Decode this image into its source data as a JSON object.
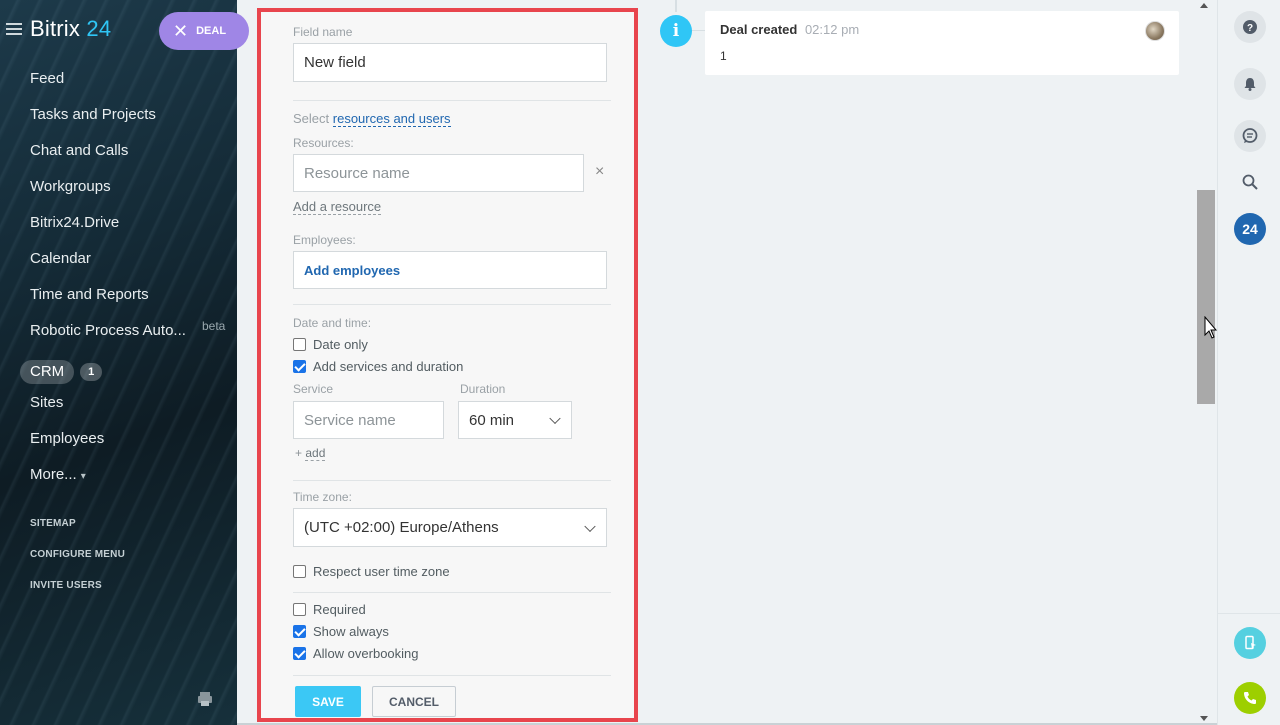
{
  "sidebar": {
    "logo_main": "Bitrix",
    "logo_num": "24",
    "deal_pill_label": "DEAL",
    "items": [
      {
        "label": "Feed"
      },
      {
        "label": "Tasks and Projects"
      },
      {
        "label": "Chat and Calls"
      },
      {
        "label": "Workgroups"
      },
      {
        "label": "Bitrix24.Drive"
      },
      {
        "label": "Calendar"
      },
      {
        "label": "Time and Reports"
      },
      {
        "label": "Robotic Process Auto...",
        "tag": "beta"
      }
    ],
    "crm": {
      "label": "CRM",
      "count": "1"
    },
    "items_after": [
      {
        "label": "Sites"
      },
      {
        "label": "Employees"
      },
      {
        "label": "More..."
      }
    ],
    "small_links": [
      "SITEMAP",
      "CONFIGURE MENU",
      "INVITE USERS"
    ]
  },
  "form": {
    "field_name_label": "Field name",
    "field_name_value": "New field",
    "select_prefix": "Select",
    "select_link": "resources and users",
    "resources_label": "Resources:",
    "resource_placeholder": "Resource name",
    "remove_symbol": "×",
    "add_resource": "Add a resource",
    "employees_label": "Employees:",
    "add_employees": "Add employees",
    "datetime_label": "Date and time:",
    "date_only": "Date only",
    "add_services": "Add services and duration",
    "service_label": "Service",
    "duration_label": "Duration",
    "service_placeholder": "Service name",
    "duration_value": "60 min",
    "add_service_link": "add",
    "timezone_label": "Time zone:",
    "timezone_value": "(UTC +02:00) Europe/Athens",
    "respect_tz": "Respect user time zone",
    "required": "Required",
    "show_always": "Show always",
    "allow_overbooking": "Allow overbooking",
    "save": "SAVE",
    "cancel": "CANCEL",
    "checks": {
      "date_only": false,
      "add_services": true,
      "respect_tz": false,
      "required": false,
      "show_always": true,
      "allow_overbooking": true
    }
  },
  "timeline": {
    "event_title": "Deal created",
    "event_time": "02:12 pm",
    "event_body": "1"
  },
  "rightbar": {
    "badge": "24"
  },
  "colors": {
    "accent": "#3bc8f5",
    "deal_pill": "#9f86e6",
    "highlight_border": "#e8454d",
    "link": "#2067b0",
    "phone_green": "#9dcf00"
  }
}
